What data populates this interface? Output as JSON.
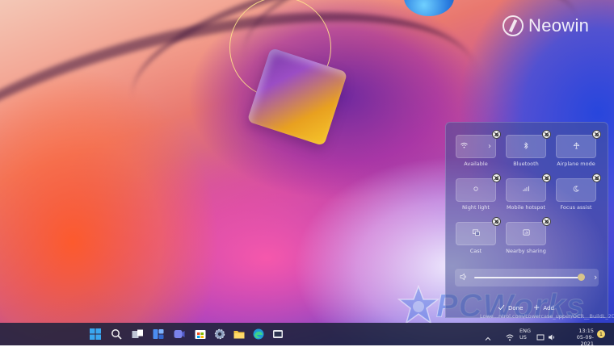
{
  "watermarks": {
    "neowin": "Neowin",
    "pcworks": "PCWorks"
  },
  "quick_settings": {
    "tiles": [
      {
        "label": "Available",
        "icon": "wifi-icon",
        "has_chevron": true
      },
      {
        "label": "Bluetooth",
        "icon": "bluetooth-icon"
      },
      {
        "label": "Airplane mode",
        "icon": "airplane-icon"
      },
      {
        "label": "Night light",
        "icon": "night-light-icon"
      },
      {
        "label": "Mobile hotspot",
        "icon": "hotspot-icon"
      },
      {
        "label": "Focus assist",
        "icon": "moon-icon"
      },
      {
        "label": "Cast",
        "icon": "cast-icon"
      },
      {
        "label": "Nearby sharing",
        "icon": "nearby-sharing-icon"
      }
    ],
    "volume": {
      "level": 0.93,
      "icon": "speaker-icon",
      "chevron": "›"
    },
    "done_label": "Done",
    "add_label": "Add"
  },
  "overlay_url": "Lowe...ntrol.com/Lowercase_upper/OCR__BuildL_2D1",
  "taskbar": {
    "icons": [
      "windows-start-icon",
      "search-icon",
      "task-view-icon",
      "widgets-icon",
      "teams-chat-icon",
      "store-icon",
      "settings-icon",
      "file-explorer-icon",
      "edge-icon",
      "taskbar-app-icon"
    ],
    "tray": {
      "lang_line1": "ENG",
      "lang_line2": "US",
      "time": "13:15",
      "date": "05-09-2021",
      "notification_count": "1"
    }
  }
}
